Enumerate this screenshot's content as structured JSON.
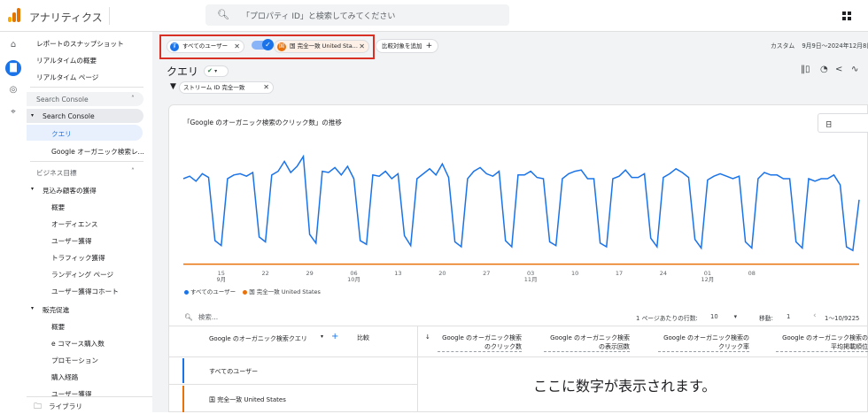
{
  "app": {
    "name": "アナリティクス",
    "search_placeholder": "「プロパティ ID」と検索してみてください"
  },
  "rail": {
    "icons": [
      "home-icon",
      "reports-icon",
      "explore-icon",
      "advertising-icon"
    ]
  },
  "sidebar": {
    "top_links": [
      "レポートのスナップショット",
      "リアルタイムの概要",
      "リアルタイム ページ"
    ],
    "section_search_console": "Search Console",
    "search_console_group": "Search Console",
    "search_console_items": [
      "クエリ",
      "Google オーガニック検索レ..."
    ],
    "section_business": "ビジネス目標",
    "acquisition_group": "見込み顧客の獲得",
    "acquisition_items": [
      "概要",
      "オーディエンス",
      "ユーザー獲得",
      "トラフィック獲得",
      "ランディング ページ",
      "ユーザー獲得コホート"
    ],
    "sales_group": "販売促進",
    "sales_items": [
      "概要",
      "e コマース購入数",
      "プロモーション",
      "購入経路"
    ],
    "cut_item": "ユーザー獲得",
    "library": "ライブラリ"
  },
  "comparisons": {
    "chip1": {
      "letter": "す",
      "label": "すべてのユーザー",
      "color": "#1a73e8"
    },
    "chip2": {
      "letter": "国",
      "label": "国 完全一致 United Sta...",
      "color": "#e8710a"
    },
    "add_label": "比較対象を追加",
    "date_label": "カスタム",
    "date_range": "9月9日～2024年12月8日"
  },
  "report": {
    "title": "クエリ",
    "filter_chip": "ストリーム ID 完全一致"
  },
  "chart_data": {
    "type": "line",
    "title": "「Google のオーガニック検索のクリック数」の推移",
    "granularity": "日",
    "x_ticks": [
      {
        "day": "15",
        "month": "9月"
      },
      {
        "day": "22",
        "month": ""
      },
      {
        "day": "29",
        "month": ""
      },
      {
        "day": "06",
        "month": "10月"
      },
      {
        "day": "13",
        "month": ""
      },
      {
        "day": "20",
        "month": ""
      },
      {
        "day": "27",
        "month": ""
      },
      {
        "day": "03",
        "month": "11月"
      },
      {
        "day": "10",
        "month": ""
      },
      {
        "day": "17",
        "month": ""
      },
      {
        "day": "24",
        "month": ""
      },
      {
        "day": "01",
        "month": "12月"
      },
      {
        "day": "08",
        "month": ""
      }
    ],
    "series": [
      {
        "name": "すべてのユーザー",
        "color": "#1a73e8",
        "values": [
          70,
          72,
          68,
          74,
          71,
          20,
          16,
          70,
          73,
          74,
          72,
          75,
          23,
          19,
          73,
          76,
          84,
          75,
          80,
          88,
          25,
          18,
          76,
          75,
          79,
          73,
          80,
          70,
          20,
          17,
          73,
          72,
          76,
          70,
          74,
          24,
          16,
          70,
          74,
          78,
          73,
          82,
          71,
          19,
          15,
          70,
          76,
          79,
          74,
          72,
          76,
          20,
          15,
          73,
          73,
          76,
          71,
          70,
          19,
          16,
          70,
          74,
          76,
          77,
          70,
          70,
          18,
          15,
          70,
          72,
          77,
          71,
          71,
          74,
          22,
          15,
          71,
          74,
          78,
          75,
          71,
          21,
          14,
          69,
          72,
          74,
          72,
          70,
          72,
          19,
          14,
          70,
          75,
          73,
          73,
          70,
          70,
          19,
          14,
          70,
          68,
          70,
          70,
          73,
          65,
          15,
          12,
          53
        ]
      },
      {
        "name": "国 完全一致 United States",
        "color": "#e8710a",
        "values": [
          1,
          1,
          1,
          1,
          1,
          1,
          1,
          1,
          1,
          1,
          1,
          1,
          1,
          1,
          1,
          1,
          1,
          1,
          1,
          1,
          1,
          1,
          1,
          1,
          1,
          1,
          1,
          1,
          1,
          1,
          1,
          1,
          1,
          1,
          1,
          1,
          1,
          1,
          1,
          1,
          1,
          1,
          1,
          1,
          1,
          1,
          1,
          1,
          1,
          1,
          1,
          1,
          1,
          1,
          1,
          1,
          1,
          1,
          1,
          1,
          1,
          1,
          1,
          1,
          1,
          1,
          1,
          1,
          1,
          1,
          1,
          1,
          1,
          1,
          1,
          1,
          1,
          1,
          1,
          1,
          1,
          1,
          1,
          1,
          1,
          1,
          1,
          1,
          1,
          1,
          1,
          1,
          1,
          1,
          1,
          1,
          1,
          1,
          1,
          1,
          1,
          1,
          1,
          1,
          1,
          1,
          1,
          1
        ]
      }
    ],
    "ylim": [
      0,
      100
    ]
  },
  "table": {
    "search_placeholder": "検索...",
    "rows_per_page_label": "1 ページあたりの行数:",
    "rows_per_page": "10",
    "goto_label": "移動:",
    "goto_value": "1",
    "range": "1～10/9225",
    "dim_header": "Google のオーガニック検索クエリ",
    "compare_header": "比較",
    "metrics": [
      {
        "l1": "Google のオーガニック検索",
        "l2": "のクリック数"
      },
      {
        "l1": "Google のオーガニック検索",
        "l2": "の表示回数"
      },
      {
        "l1": "Google のオーガニック検索の",
        "l2": "クリック率"
      },
      {
        "l1": "Google のオーガニック検索の",
        "l2": "平均掲載順位"
      }
    ],
    "rows": [
      "すべてのユーザー",
      "国 完全一致 United States"
    ],
    "overlay": "ここに数字が表示されます。"
  }
}
